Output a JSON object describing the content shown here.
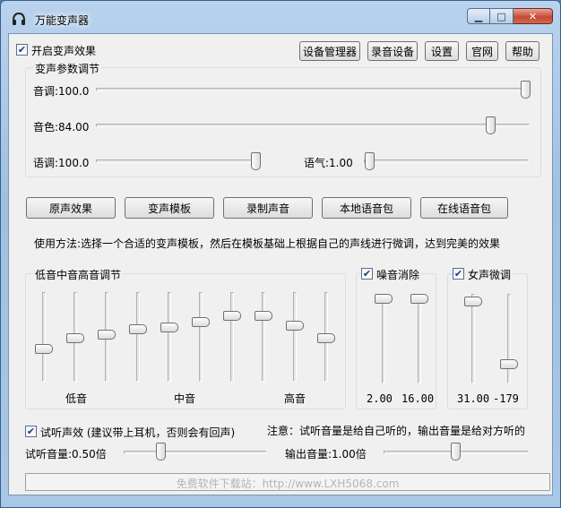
{
  "window": {
    "title": "万能变声器"
  },
  "header": {
    "enable_label": "开启变声效果",
    "enable_checked": true,
    "buttons": [
      "设备管理器",
      "录音设备",
      "设置",
      "官网",
      "帮助"
    ]
  },
  "params": {
    "title": "变声参数调节",
    "pitch": {
      "label": "音调:100.0",
      "value": 100.0
    },
    "timbre": {
      "label": "音色:84.00",
      "value": 84.0
    },
    "speed": {
      "label": "语调:100.0",
      "value": 100.0
    },
    "tone": {
      "label": "语气:1.00",
      "value": 1.0
    }
  },
  "actions": [
    "原声效果",
    "变声模板",
    "录制声音",
    "本地语音包",
    "在线语音包"
  ],
  "instructions": "使用方法:选择一个合适的变声模板，然后在模板基础上根据自己的声线进行微调，达到完美的效果",
  "eq": {
    "title": "低音中音高音调节",
    "levels": [
      0.35,
      0.48,
      0.53,
      0.6,
      0.62,
      0.68,
      0.76,
      0.76,
      0.64,
      0.48
    ],
    "labels": {
      "low": "低音",
      "mid": "中音",
      "high": "高音"
    }
  },
  "noise": {
    "label": "噪音消除",
    "checked": true,
    "values": [
      "2.00",
      "16.00"
    ],
    "levels": [
      1.0,
      1.0
    ]
  },
  "female": {
    "label": "女声微调",
    "checked": true,
    "values": [
      "31.00",
      "-179"
    ],
    "levels": [
      0.97,
      0.18
    ]
  },
  "monitor": {
    "label": "试听声效 (建议带上耳机，否则会有回声)",
    "checked": true,
    "note": "注意：试听音量是给自己听的，输出音量是给对方听的",
    "listen_volume": {
      "label": "试听音量:0.50倍",
      "value": 0.5
    },
    "output_volume": {
      "label": "输出音量:1.00倍",
      "value": 1.0
    }
  },
  "status": {
    "watermark": "免费软件下载站：http://www.LXH5068.com"
  }
}
